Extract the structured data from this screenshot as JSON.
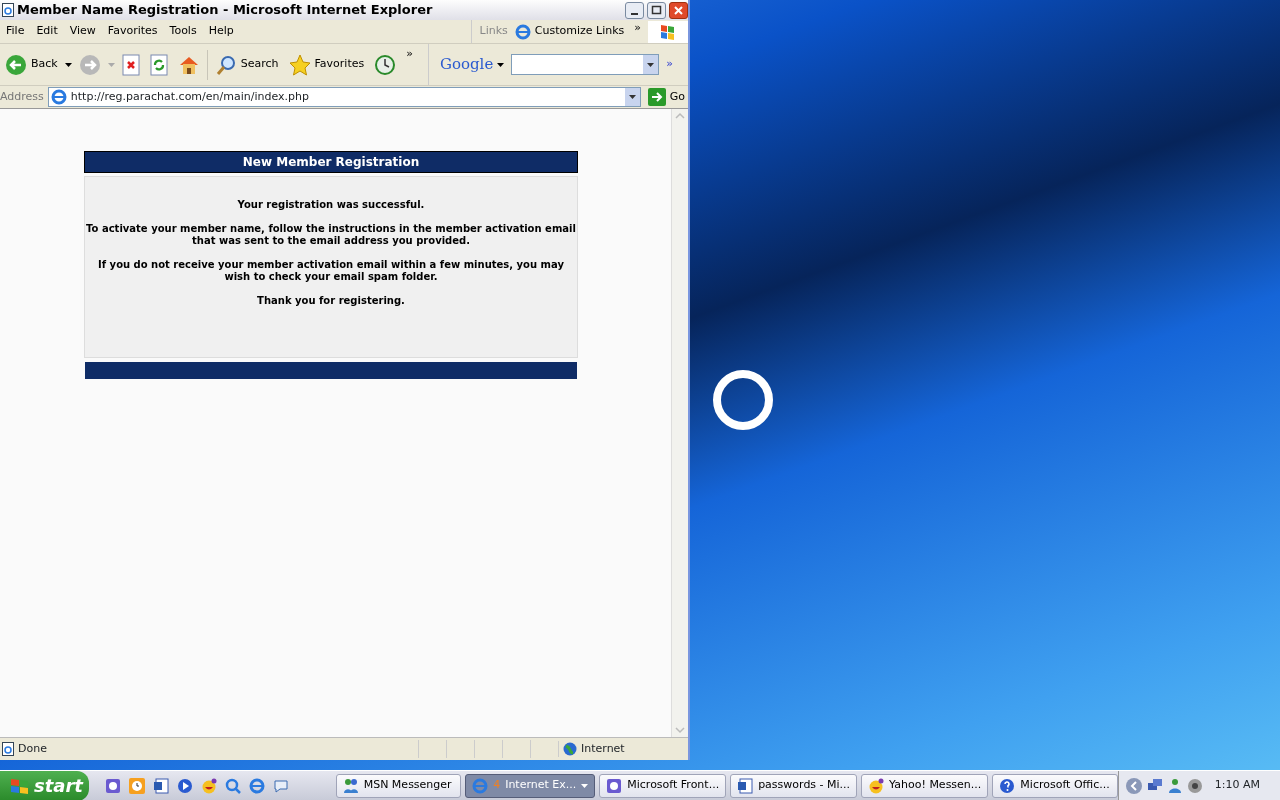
{
  "window": {
    "title": "Member Name Registration - Microsoft Internet Explorer"
  },
  "menu": [
    "File",
    "Edit",
    "View",
    "Favorites",
    "Tools",
    "Help"
  ],
  "links_bar": {
    "label": "Links",
    "item": "Customize Links",
    "overflow": "»"
  },
  "toolbar": [
    {
      "kind": "back",
      "label": "Back"
    },
    {
      "kind": "forward"
    },
    {
      "kind": "stop"
    },
    {
      "kind": "refresh"
    },
    {
      "kind": "home"
    },
    {
      "kind": "search",
      "label": "Search"
    },
    {
      "kind": "favorites",
      "label": "Favorites"
    },
    {
      "kind": "history"
    }
  ],
  "toolbar_overflow": "»",
  "google": {
    "label": "Google",
    "overflow": "»"
  },
  "address": {
    "label": "Address",
    "value": "http://reg.parachat.com/en/main/index.php",
    "go": "Go"
  },
  "panel": {
    "title": "New Member Registration",
    "paragraphs": [
      [
        "Your registration was successful."
      ],
      [
        "To activate your member name, follow the instructions in the member activation email",
        "that was sent to the email address you provided."
      ],
      [
        "If you do not receive your member activation email within a few minutes, you may",
        "wish to check your email spam folder."
      ],
      [
        "Thank you for registering."
      ]
    ]
  },
  "status_bar": {
    "text": "Done",
    "zone": "Internet"
  },
  "taskbar": {
    "start": "start",
    "buttons": [
      {
        "label": "MSN Messenger",
        "kind": "msn",
        "selected": false
      },
      {
        "label": "Internet Ex...",
        "count": "4",
        "kind": "ie",
        "selected": true
      },
      {
        "label": "Microsoft Front...",
        "kind": "frontpage",
        "selected": false
      },
      {
        "label": "passwords - Mi...",
        "kind": "word",
        "selected": false
      },
      {
        "label": "Yahoo! Messen...",
        "kind": "yahoo",
        "selected": false
      },
      {
        "label": "Microsoft Offic...",
        "kind": "help",
        "selected": false
      }
    ],
    "clock": "1:10 AM"
  }
}
